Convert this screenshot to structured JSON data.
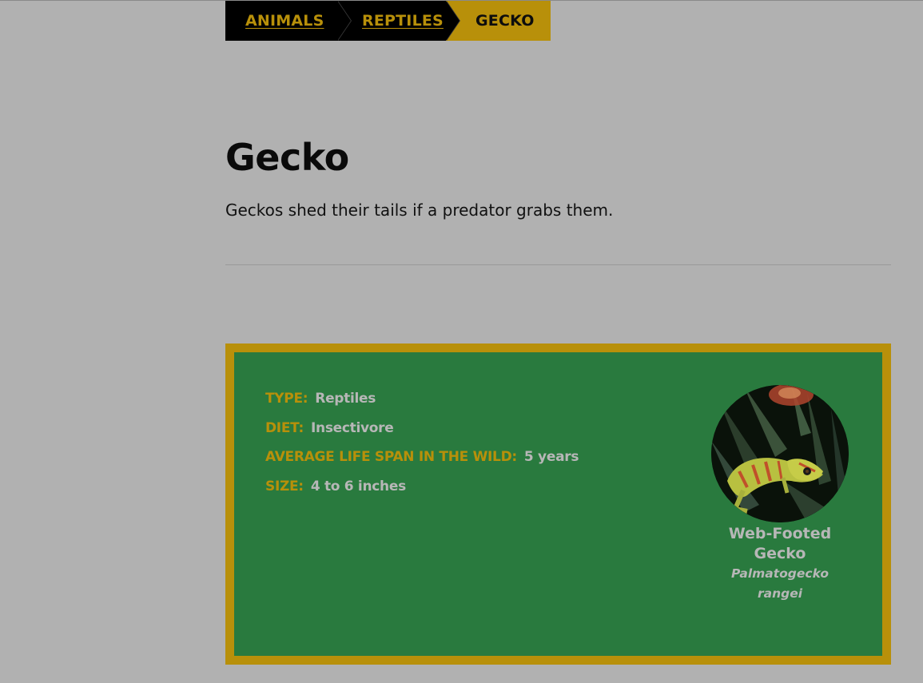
{
  "breadcrumb": {
    "items": [
      {
        "label": "ANIMALS"
      },
      {
        "label": "REPTILES"
      },
      {
        "label": "GECKO"
      }
    ]
  },
  "page": {
    "title": "Gecko",
    "subtitle": "Geckos shed their tails if a predator grabs them."
  },
  "fact_card": {
    "facts": [
      {
        "label": "TYPE:",
        "value": "Reptiles"
      },
      {
        "label": "DIET:",
        "value": "Insectivore"
      },
      {
        "label": "AVERAGE LIFE SPAN IN THE WILD:",
        "value": "5 years"
      },
      {
        "label": "SIZE:",
        "value": "4 to 6 inches"
      }
    ],
    "image": {
      "name": "Web-Footed Gecko",
      "scientific_name": "Palmatogecko rangei"
    }
  },
  "colors": {
    "page_background": "#b1b1b1",
    "accent_gold": "#b8900a",
    "card_green": "#297a3e",
    "breadcrumb_dark": "#000000"
  }
}
